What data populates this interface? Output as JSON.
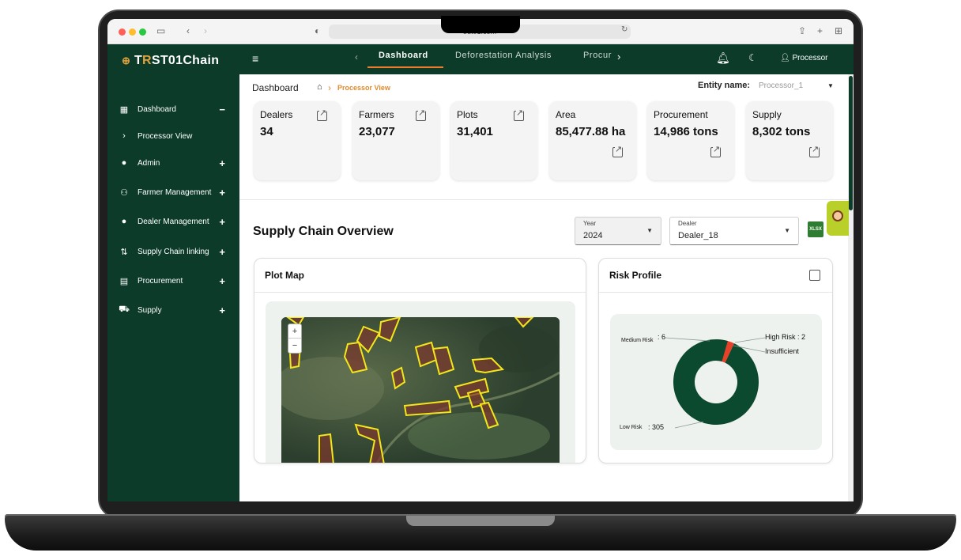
{
  "browser": {
    "url": "trst01.com"
  },
  "app": {
    "logo_prefix": "T",
    "logo_mid": "R",
    "logo_rest": "ST01Chain"
  },
  "sidebar": {
    "items": [
      {
        "label": "Dashboard",
        "icon": "dashboard-icon",
        "action": "−"
      },
      {
        "label": "Processor View",
        "icon": "chevron-right-icon",
        "action": ""
      },
      {
        "label": "Admin",
        "icon": "person-icon",
        "action": "+"
      },
      {
        "label": "Farmer Management",
        "icon": "people-icon",
        "action": "+"
      },
      {
        "label": "Dealer Management",
        "icon": "person-icon",
        "action": "+"
      },
      {
        "label": "Supply Chain linking",
        "icon": "swap-vertical-icon",
        "action": "+"
      },
      {
        "label": "Procurement",
        "icon": "store-icon",
        "action": "+"
      },
      {
        "label": "Supply",
        "icon": "truck-icon",
        "action": "+"
      }
    ]
  },
  "topbar": {
    "tabs": [
      "Dashboard",
      "Deforestation Analysis",
      "Procur"
    ],
    "user": "Processor"
  },
  "breadcrumb": {
    "root": "Dashboard",
    "current": "Processor View"
  },
  "entity": {
    "label": "Entity name:",
    "placeholder": "Processor_1"
  },
  "cards": [
    {
      "label": "Dealers",
      "value": "34"
    },
    {
      "label": "Farmers",
      "value": "23,077"
    },
    {
      "label": "Plots",
      "value": "31,401"
    },
    {
      "label": "Area",
      "value": "85,477.88 ha"
    },
    {
      "label": "Procurement",
      "value": "14,986 tons"
    },
    {
      "label": "Supply",
      "value": "8,302 tons"
    }
  ],
  "overview": {
    "title": "Supply Chain Overview",
    "year": {
      "label": "Year",
      "value": "2024"
    },
    "dealer": {
      "label": "Dealer",
      "value": "Dealer_18"
    },
    "export": "XLSX"
  },
  "plot_map": {
    "title": "Plot Map",
    "zoom_in": "+",
    "zoom_out": "−"
  },
  "risk_profile": {
    "title": "Risk Profile",
    "labels": {
      "medium_name": "Medium Risk",
      "medium_value": ": 6",
      "high": "High Risk : 2",
      "insufficient": "Insufficient",
      "low_name": "Low Risk",
      "low_value": ": 305"
    },
    "colors": {
      "low": "#0c4a2f",
      "high": "#e8412a",
      "medium": "#8a6a18"
    }
  },
  "chart_data": {
    "type": "pie",
    "series": [
      {
        "name": "Low Risk",
        "value": 305
      },
      {
        "name": "Medium Risk",
        "value": 6
      },
      {
        "name": "High Risk",
        "value": 2
      },
      {
        "name": "Insufficient",
        "value": 0
      }
    ]
  }
}
